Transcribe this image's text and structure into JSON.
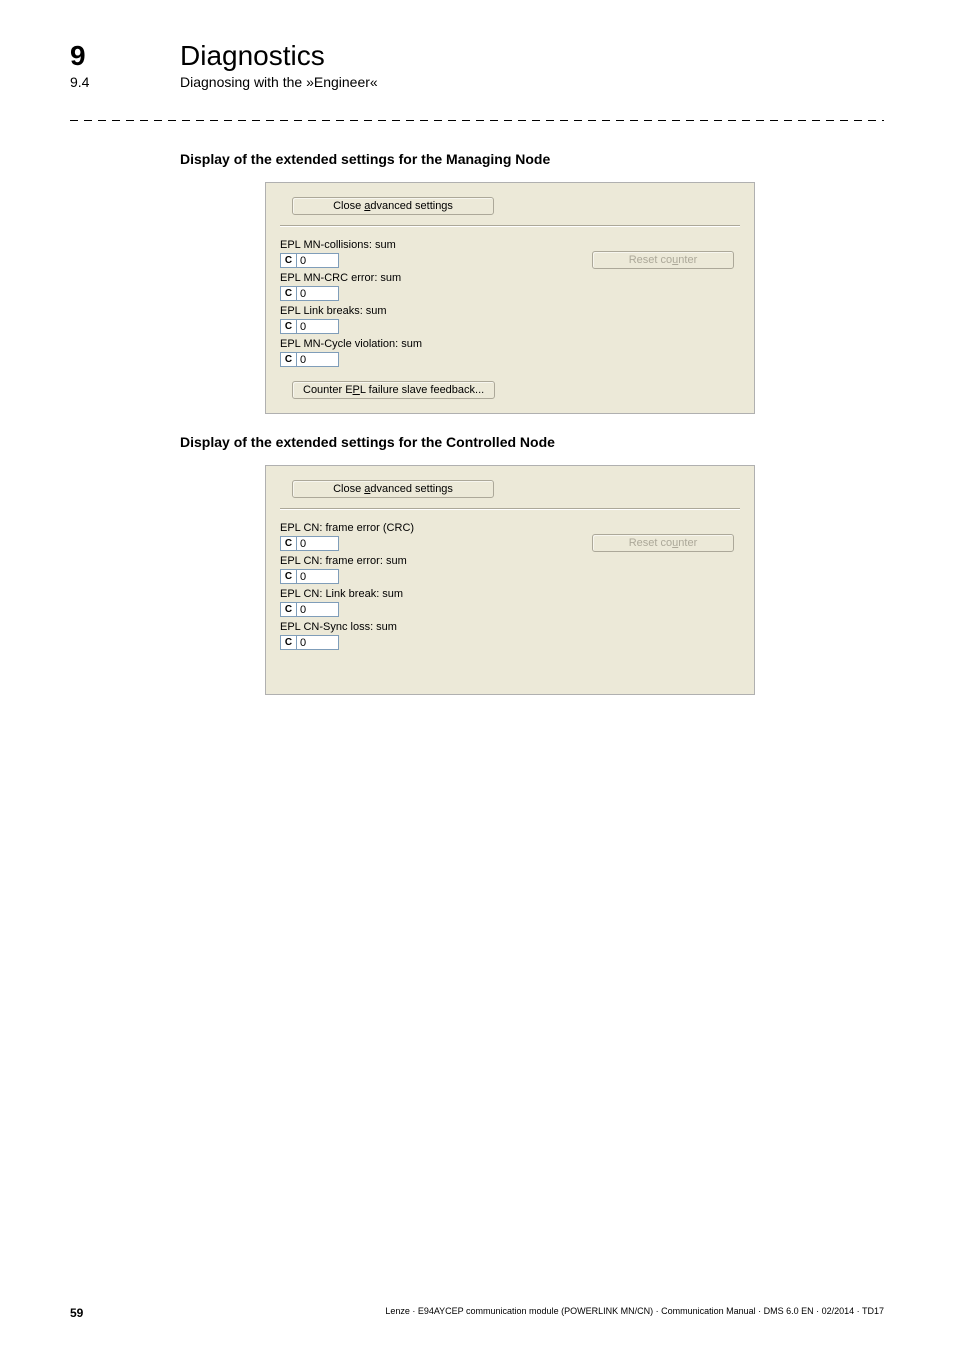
{
  "header": {
    "chapter_num": "9",
    "chapter_title": "Diagnostics",
    "sub_num": "9.4",
    "sub_title": "Diagnosing with the »Engineer«"
  },
  "section1": {
    "heading": "Display of the extended settings for the Managing Node",
    "close_pre": "Close ",
    "close_u": "a",
    "close_post": "dvanced settings",
    "reset_pre": "Reset co",
    "reset_u": "u",
    "reset_post": "nter",
    "fields": [
      {
        "label": "EPL MN-collisions: sum",
        "c": "C",
        "val": "0"
      },
      {
        "label": "EPL MN-CRC error: sum",
        "c": "C",
        "val": "0"
      },
      {
        "label": "EPL Link breaks: sum",
        "c": "C",
        "val": "0"
      },
      {
        "label": "EPL MN-Cycle violation: sum",
        "c": "C",
        "val": "0"
      }
    ],
    "feedback_pre": "Counter E",
    "feedback_u": "P",
    "feedback_post": "L failure slave feedback..."
  },
  "section2": {
    "heading": "Display of the extended settings for the Controlled Node",
    "close_pre": "Close ",
    "close_u": "a",
    "close_post": "dvanced settings",
    "reset_pre": "Reset co",
    "reset_u": "u",
    "reset_post": "nter",
    "fields": [
      {
        "label": "EPL CN: frame error (CRC)",
        "c": "C",
        "val": "0"
      },
      {
        "label": "EPL CN: frame error: sum",
        "c": "C",
        "val": "0"
      },
      {
        "label": "EPL CN: Link break: sum",
        "c": "C",
        "val": "0"
      },
      {
        "label": "EPL CN-Sync loss: sum",
        "c": "C",
        "val": "0"
      }
    ]
  },
  "footer": {
    "page_num": "59",
    "text": "Lenze · E94AYCEP communication module (POWERLINK MN/CN) · Communication Manual · DMS 6.0 EN · 02/2014 · TD17"
  }
}
